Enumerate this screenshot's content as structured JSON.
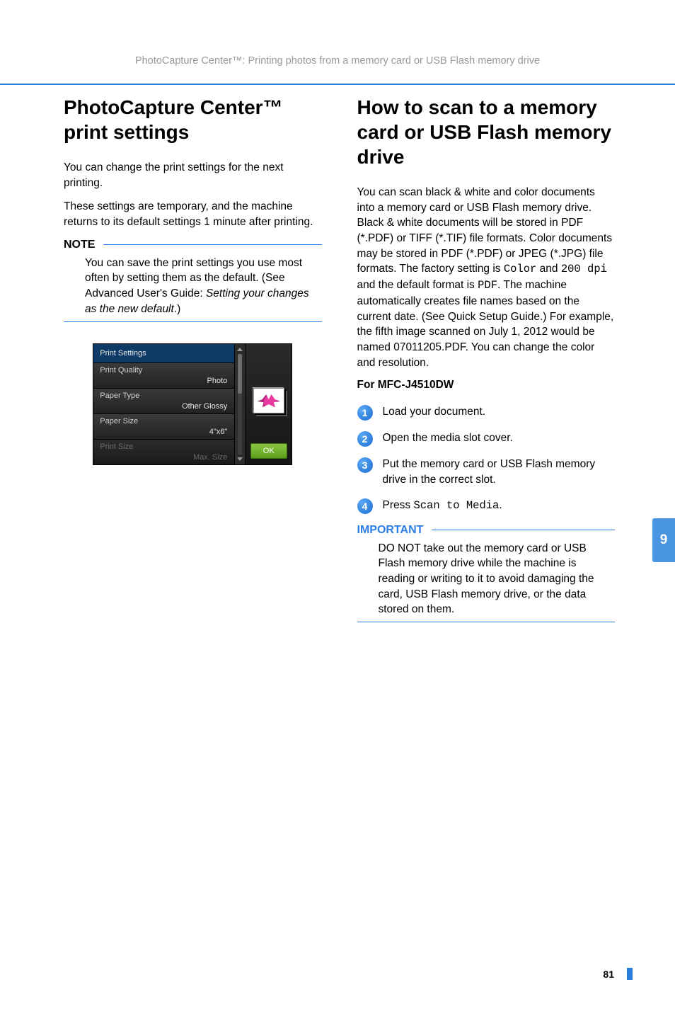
{
  "header": "PhotoCapture Center™: Printing photos from a memory card or USB Flash memory drive",
  "left": {
    "title": "PhotoCapture Center™ print settings",
    "p1": "You can change the print settings for the next printing.",
    "p2": "These settings are temporary, and the machine returns to its default settings 1 minute after printing.",
    "note_label": "NOTE",
    "note_a": "You can save the print settings you use most often by setting them as the default. (See Advanced User's Guide: ",
    "note_b": "Setting your changes as the new default",
    "note_c": ".)"
  },
  "lcd": {
    "title": "Print Settings",
    "rows": [
      {
        "label": "Print Quality",
        "value": "Photo"
      },
      {
        "label": "Paper Type",
        "value": "Other Glossy"
      },
      {
        "label": "Paper Size",
        "value": "4\"x6\""
      },
      {
        "label": "Print Size",
        "value": "Max. Size",
        "dim": true
      }
    ],
    "ok": "OK"
  },
  "right": {
    "title": "How to scan to a memory card or USB Flash memory drive",
    "p1a": "You can scan black & white and color documents into a memory card or USB Flash memory drive. Black & white documents will be stored in PDF (*.PDF) or TIFF (*.TIF) file formats. Color documents may be stored in PDF (*.PDF) or JPEG (*.JPG) file formats. The factory setting is ",
    "p1_code1": "Color",
    "p1b": " and ",
    "p1_code2": "200 dpi",
    "p1c": " and the default format is ",
    "p1_code3": "PDF",
    "p1d": ". The machine automatically creates file names based on the current date. (See Quick Setup Guide.) For example, the fifth image scanned on July 1, 2012 would be named 07011205.PDF. You can change the color and resolution.",
    "subhead": "For MFC-J4510DW",
    "steps": [
      "Load your document.",
      "Open the media slot cover.",
      "Put the memory card or USB Flash memory drive in the correct slot."
    ],
    "step4a": "Press ",
    "step4_code": "Scan to Media",
    "step4b": ".",
    "important_label": "IMPORTANT",
    "important_text": "DO NOT take out the memory card or USB Flash memory drive while the machine is reading or writing to it to avoid damaging the card, USB Flash memory drive, or the data stored on them."
  },
  "side_tab": "9",
  "page_number": "81"
}
